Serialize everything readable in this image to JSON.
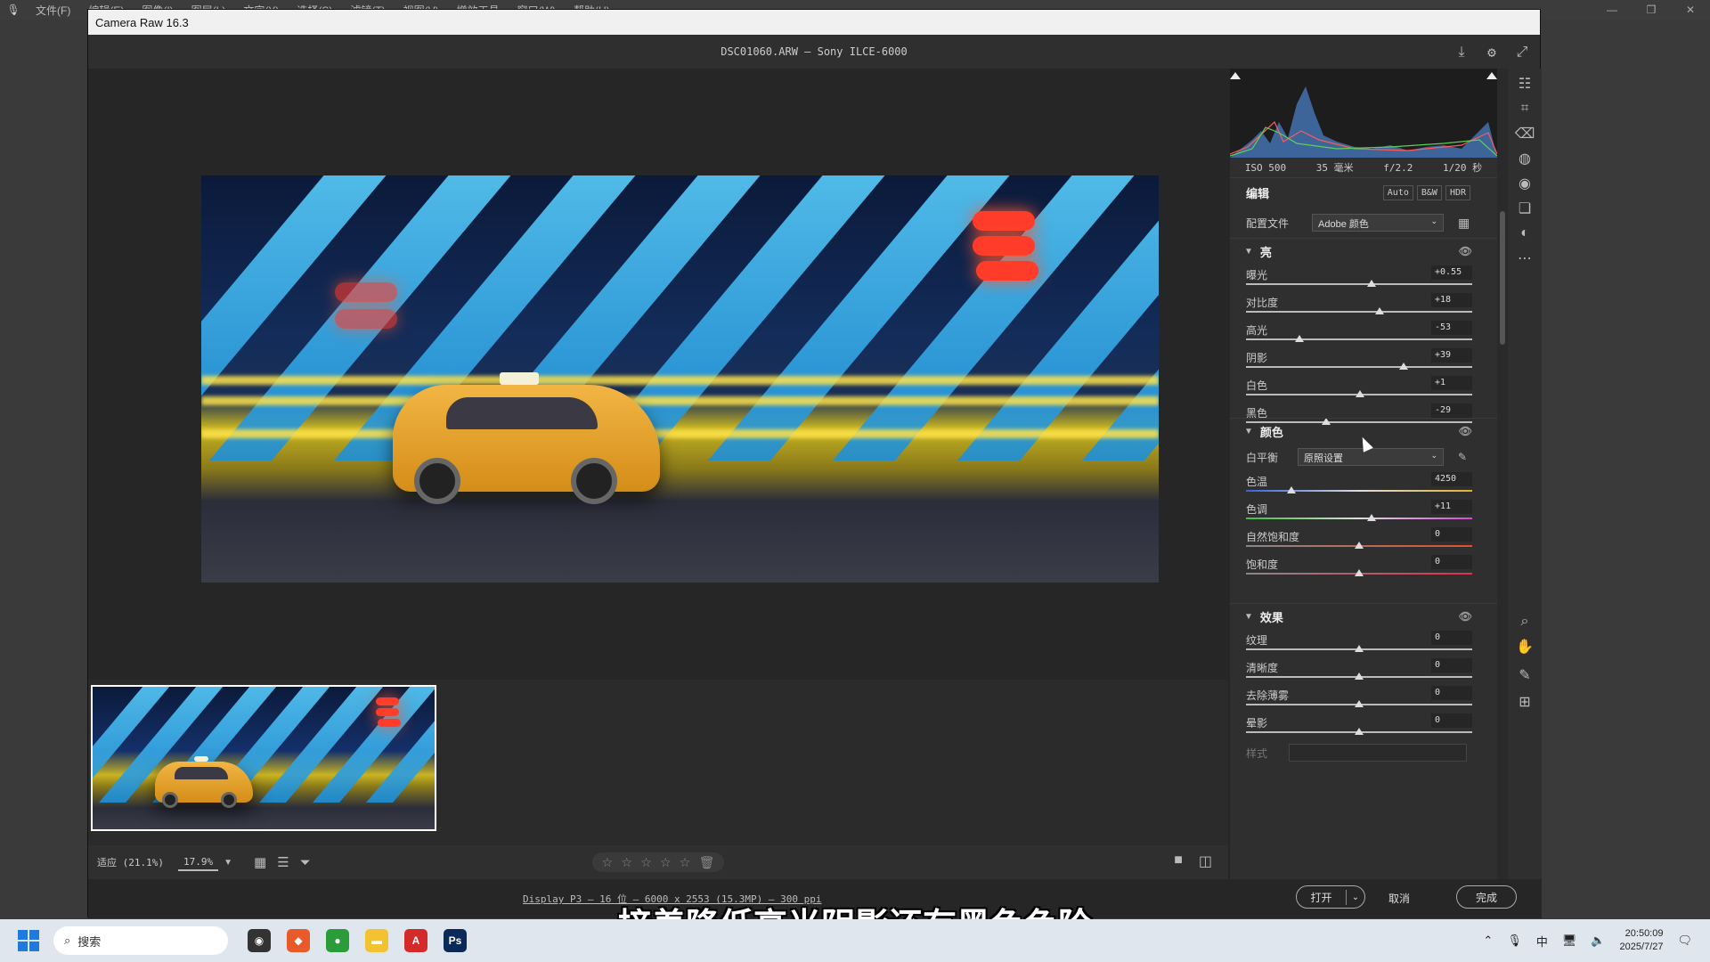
{
  "menubar": {
    "items": [
      "文件(F)",
      "编辑(E)",
      "图像(I)",
      "图层(L)",
      "文字(Y)",
      "选择(S)",
      "滤镜(T)",
      "视图(V)",
      "增效工具",
      "窗口(W)",
      "帮助(H)"
    ]
  },
  "dialog": {
    "title": "Camera Raw 16.3",
    "file_info": "DSC01060.ARW  –  Sony ILCE-6000"
  },
  "exif": {
    "iso": "ISO 500",
    "focal": "35 毫米",
    "aperture": "f/2.2",
    "shutter": "1/20 秒"
  },
  "edit": {
    "title": "编辑",
    "tags": [
      "Auto",
      "B&W",
      "HDR"
    ],
    "profile_label": "配置文件",
    "profile_value": "Adobe 颜色"
  },
  "light": {
    "title": "亮",
    "sliders": [
      {
        "label": "曝光",
        "value": "+0.55",
        "pos": 0.555
      },
      {
        "label": "对比度",
        "value": "+18",
        "pos": 0.59
      },
      {
        "label": "高光",
        "value": "-53",
        "pos": 0.235
      },
      {
        "label": "阴影",
        "value": "+39",
        "pos": 0.695
      },
      {
        "label": "白色",
        "value": "+1",
        "pos": 0.505
      },
      {
        "label": "黑色",
        "value": "-29",
        "pos": 0.355
      }
    ]
  },
  "color": {
    "title": "颜色",
    "wb_label": "白平衡",
    "wb_value": "原照设置",
    "sliders": [
      {
        "label": "色温",
        "value": "4250",
        "pos": 0.2,
        "track": "temp"
      },
      {
        "label": "色调",
        "value": "+11",
        "pos": 0.555,
        "track": "tint"
      },
      {
        "label": "自然饱和度",
        "value": "0",
        "pos": 0.5,
        "track": "vib"
      },
      {
        "label": "饱和度",
        "value": "0",
        "pos": 0.5,
        "track": "sat"
      }
    ]
  },
  "effects": {
    "title": "效果",
    "sliders": [
      {
        "label": "纹理",
        "value": "0",
        "pos": 0.5
      },
      {
        "label": "清晰度",
        "value": "0",
        "pos": 0.5
      },
      {
        "label": "去除薄雾",
        "value": "0",
        "pos": 0.5
      },
      {
        "label": "晕影",
        "value": "0",
        "pos": 0.5
      }
    ],
    "style_label": "样式"
  },
  "bottombar": {
    "zoom_fit": "适应 (21.1%)",
    "zoom_value": "17.9%"
  },
  "footer": {
    "info": "Display P3 – 16 位 – 6000 x 2553 (15.3MP) – 300 ppi",
    "open": "打开",
    "cancel": "取消",
    "done": "完成"
  },
  "subtitle": "接着降低高光阴影还有黑色色阶",
  "taskbar": {
    "search": "搜索",
    "ime": "中",
    "time": "20:50:09",
    "date": "2025/7/27"
  }
}
